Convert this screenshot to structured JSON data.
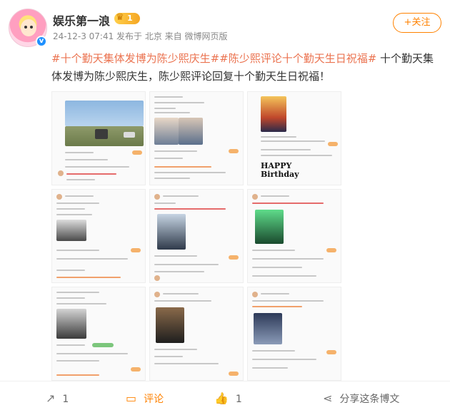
{
  "post": {
    "username": "娱乐第一浪",
    "vip_level": "1",
    "meta": "24-12-3 07:41  发布于 北京  来自 微博网页版",
    "follow_label": "+关注",
    "text_hashtag1": "#十个勤天集体发博为陈少熙庆生#",
    "text_hashtag2": "#陈少熙评论十个勤天生日祝福#",
    "text_body": " 十个勤天集体发博为陈少熙庆生，陈少熙评论回复十个勤天生日祝福！"
  },
  "images": {
    "handwriting": "HAPPY Birthday"
  },
  "footer": {
    "share_count": "1",
    "comment_label": "评论",
    "like_count": "1",
    "share_post_label": "分享这条博文"
  },
  "colors": {
    "brand_orange": "#ff8200",
    "hashtag": "#eb7350",
    "verified_blue": "#1e90ff"
  }
}
